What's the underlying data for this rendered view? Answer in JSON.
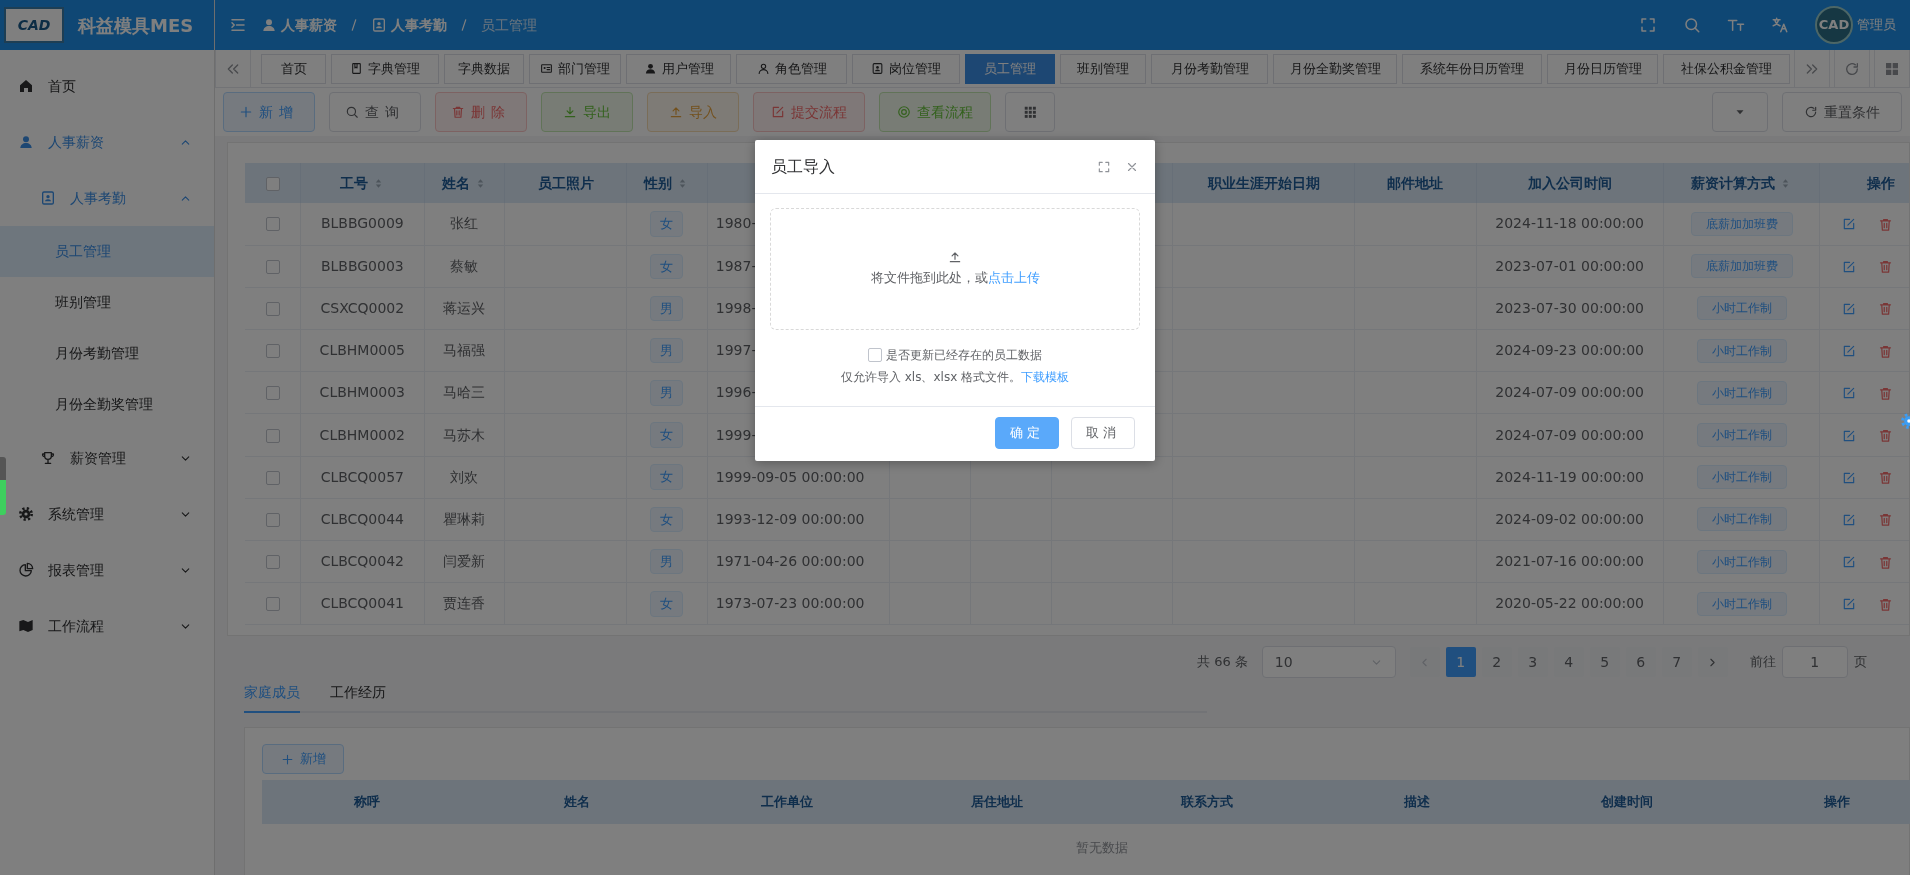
{
  "app": {
    "title": "科益模具MES",
    "logo_text": "CAD"
  },
  "breadcrumb": [
    {
      "label": "人事薪资"
    },
    {
      "label": "人事考勤"
    },
    {
      "label": "员工管理"
    }
  ],
  "user": {
    "name": "管理员",
    "avatar_text": "CAD"
  },
  "sidebar": {
    "items": [
      {
        "label": "首页",
        "selected": false
      },
      {
        "label": "人事薪资",
        "selected": false,
        "expanded": true,
        "children": [
          {
            "label": "人事考勤",
            "selected": false,
            "expanded": true,
            "children": [
              {
                "label": "员工管理",
                "selected": true
              },
              {
                "label": "班别管理",
                "selected": false
              },
              {
                "label": "月份考勤管理",
                "selected": false
              },
              {
                "label": "月份全勤奖管理",
                "selected": false
              }
            ]
          },
          {
            "label": "薪资管理",
            "selected": false,
            "expanded": false
          }
        ]
      },
      {
        "label": "系统管理",
        "selected": false,
        "expanded": false
      },
      {
        "label": "报表管理",
        "selected": false,
        "expanded": false
      },
      {
        "label": "工作流程",
        "selected": false,
        "expanded": false
      }
    ]
  },
  "tabs": [
    {
      "label": "首页",
      "selected": false
    },
    {
      "label": "字典管理",
      "selected": false
    },
    {
      "label": "字典数据",
      "selected": false
    },
    {
      "label": "部门管理",
      "selected": false
    },
    {
      "label": "用户管理",
      "selected": false
    },
    {
      "label": "角色管理",
      "selected": false
    },
    {
      "label": "岗位管理",
      "selected": false
    },
    {
      "label": "员工管理",
      "selected": true
    },
    {
      "label": "班别管理",
      "selected": false
    },
    {
      "label": "月份考勤管理",
      "selected": false
    },
    {
      "label": "月份全勤奖管理",
      "selected": false
    },
    {
      "label": "系统年份日历管理",
      "selected": false
    },
    {
      "label": "月份日历管理",
      "selected": false
    },
    {
      "label": "社保公积金管理",
      "selected": false
    }
  ],
  "toolbar": {
    "buttons": [
      {
        "label": "新增",
        "kind": "primary"
      },
      {
        "label": "查询",
        "kind": "default"
      },
      {
        "label": "删除",
        "kind": "danger"
      },
      {
        "label": "导出",
        "kind": "success"
      },
      {
        "label": "导入",
        "kind": "warning"
      },
      {
        "label": "提交流程",
        "kind": "danger"
      },
      {
        "label": "查看流程",
        "kind": "success"
      }
    ],
    "reset_button": "重置条件"
  },
  "table": {
    "all_checked": false,
    "columns": [
      {
        "label": "工号",
        "sortable": true
      },
      {
        "label": "姓名",
        "sortable": true
      },
      {
        "label": "员工照片",
        "sortable": false
      },
      {
        "label": "性别",
        "sortable": true
      },
      {
        "label": "职业生涯开始日期",
        "sortable": false
      },
      {
        "label": "邮件地址",
        "sortable": false
      },
      {
        "label": "加入公司时间",
        "sortable": false
      },
      {
        "label": "薪资计算方式",
        "sortable": true
      },
      {
        "label": "操作",
        "sortable": false
      }
    ],
    "rows": [
      {
        "checked": false,
        "id": "BLBBG0009",
        "name": "张红",
        "gender": "女",
        "birth": "1980-",
        "joined": "2024-11-18 00:00:00",
        "pay": "底薪加加班费"
      },
      {
        "checked": false,
        "id": "BLBBG0003",
        "name": "蔡敏",
        "gender": "女",
        "birth": "1987-",
        "joined": "2023-07-01 00:00:00",
        "pay": "底薪加加班费"
      },
      {
        "checked": false,
        "id": "CSXCQ0002",
        "name": "蒋运兴",
        "gender": "男",
        "birth": "1998-",
        "joined": "2023-07-30 00:00:00",
        "pay": "小时工作制"
      },
      {
        "checked": false,
        "id": "CLBHM0005",
        "name": "马福强",
        "gender": "男",
        "birth": "1997-",
        "joined": "2024-09-23 00:00:00",
        "pay": "小时工作制"
      },
      {
        "checked": false,
        "id": "CLBHM0003",
        "name": "马哈三",
        "gender": "男",
        "birth": "1996-",
        "joined": "2024-07-09 00:00:00",
        "pay": "小时工作制"
      },
      {
        "checked": false,
        "id": "CLBHM0002",
        "name": "马苏木",
        "gender": "女",
        "birth": "1999-",
        "joined": "2024-07-09 00:00:00",
        "pay": "小时工作制"
      },
      {
        "checked": false,
        "id": "CLBCQ0057",
        "name": "刘欢",
        "gender": "女",
        "birth": "1999-09-05 00:00:00",
        "joined": "2024-11-19 00:00:00",
        "pay": "小时工作制"
      },
      {
        "checked": false,
        "id": "CLBCQ0044",
        "name": "瞿琳莉",
        "gender": "女",
        "birth": "1993-12-09 00:00:00",
        "joined": "2024-09-02 00:00:00",
        "pay": "小时工作制"
      },
      {
        "checked": false,
        "id": "CLBCQ0042",
        "name": "闫爱新",
        "gender": "男",
        "birth": "1971-04-26 00:00:00",
        "joined": "2021-07-16 00:00:00",
        "pay": "小时工作制"
      },
      {
        "checked": false,
        "id": "CLBCQ0041",
        "name": "贾连香",
        "gender": "女",
        "birth": "1973-07-23 00:00:00",
        "joined": "2020-05-22 00:00:00",
        "pay": "小时工作制"
      }
    ]
  },
  "pagination": {
    "total": "共 66 条",
    "page_size": "10",
    "prev_disabled": true,
    "pages": [
      {
        "label": "1",
        "selected": true
      },
      {
        "label": "2",
        "selected": false
      },
      {
        "label": "3",
        "selected": false
      },
      {
        "label": "4",
        "selected": false
      },
      {
        "label": "5",
        "selected": false
      },
      {
        "label": "6",
        "selected": false
      },
      {
        "label": "7",
        "selected": false
      }
    ],
    "goto_label": "前往",
    "goto_value": "1",
    "page_suffix": "页"
  },
  "detail_tabs": [
    {
      "label": "家庭成员",
      "selected": true
    },
    {
      "label": "工作经历",
      "selected": false
    }
  ],
  "detail": {
    "add_button": "新增",
    "columns": [
      "称呼",
      "姓名",
      "工作单位",
      "居住地址",
      "联系方式",
      "描述",
      "创建时间",
      "操作"
    ],
    "empty_text": "暂无数据"
  },
  "modal": {
    "title": "员工导入",
    "upload_text": "将文件拖到此处，或",
    "upload_link": "点击上传",
    "update_option": {
      "label": "是否更新已经存在的员工数据",
      "checked": false
    },
    "hint": "仅允许导入 xls、xlsx 格式文件。",
    "template_link": "下载模板",
    "buttons": [
      {
        "label": "确定",
        "kind": "primary"
      },
      {
        "label": "取消",
        "kind": "default"
      }
    ]
  }
}
